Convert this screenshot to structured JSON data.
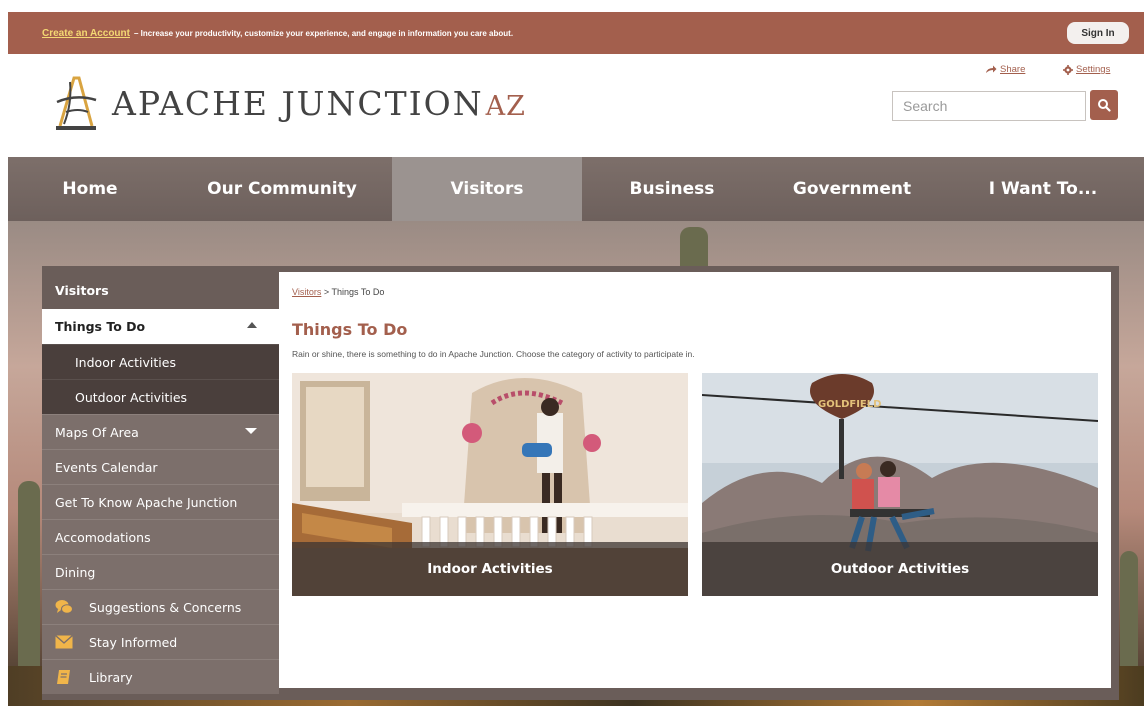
{
  "topbar": {
    "create_link": "Create an Account",
    "promo": "– Increase your productivity, customize your experience, and engage in information you care about.",
    "sign_in": "Sign In"
  },
  "header": {
    "logo_main": "APACHE JUNCTION",
    "logo_suffix": "AZ",
    "share_label": "Share",
    "settings_label": "Settings",
    "search_placeholder": "Search"
  },
  "nav": {
    "items": [
      {
        "label": "Home",
        "active": false
      },
      {
        "label": "Our Community",
        "active": false
      },
      {
        "label": "Visitors",
        "active": true
      },
      {
        "label": "Business",
        "active": false
      },
      {
        "label": "Government",
        "active": false
      },
      {
        "label": "I Want To...",
        "active": false
      }
    ]
  },
  "sidebar": {
    "heading": "Visitors",
    "items": [
      {
        "label": "Things To Do",
        "state": "current",
        "caret": "up"
      },
      {
        "label": "Indoor Activities",
        "state": "sub"
      },
      {
        "label": "Outdoor Activities",
        "state": "sub"
      },
      {
        "label": "Maps Of Area",
        "caret": "down"
      },
      {
        "label": "Events Calendar"
      },
      {
        "label": "Get To Know Apache Junction"
      },
      {
        "label": "Accomodations"
      },
      {
        "label": "Dining"
      },
      {
        "label": "Suggestions & Concerns",
        "icon": "chat-bubbles-icon"
      },
      {
        "label": "Stay Informed",
        "icon": "envelope-icon"
      },
      {
        "label": "Library",
        "icon": "book-icon"
      }
    ]
  },
  "main": {
    "breadcrumb_parent": "Visitors",
    "breadcrumb_separator": ">",
    "breadcrumb_current": "Things To Do",
    "title": "Things To Do",
    "intro": "Rain or shine, there is something to do in Apache Junction. Choose the category of activity to participate in.",
    "tiles": [
      {
        "label": "Indoor Activities"
      },
      {
        "label": "Outdoor Activities"
      }
    ],
    "zipline_sign_text": "GOLDFIELD"
  },
  "colors": {
    "brand": "#a35f4d",
    "nav_bg": "#75685f",
    "nav_active": "#9b9390",
    "sidebar_bg": "#7c6f6b",
    "sidebar_sub": "#4a3f3c",
    "link_gold": "#f4d873"
  }
}
